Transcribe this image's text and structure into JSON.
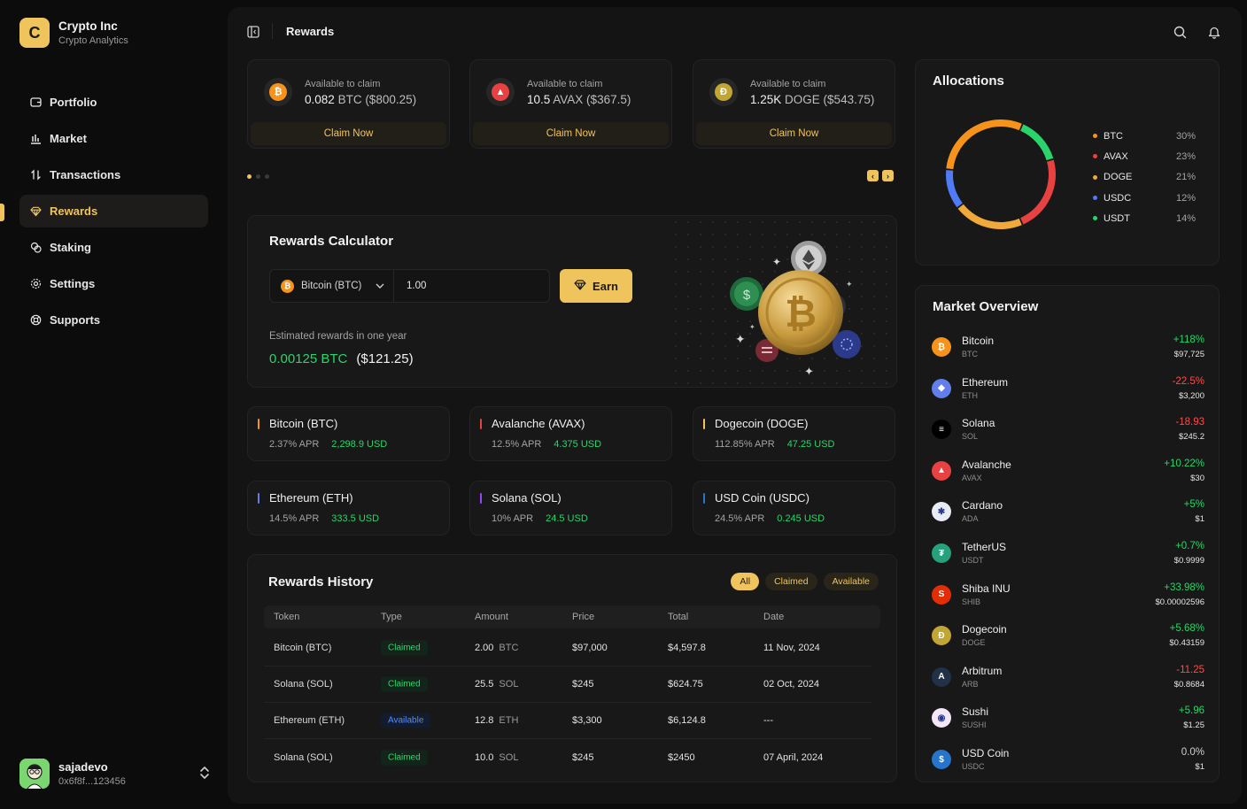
{
  "brand": {
    "logo_letter": "C",
    "name": "Crypto Inc",
    "subtitle": "Crypto Analytics"
  },
  "nav": [
    {
      "label": "Portfolio",
      "icon": "wallet-icon",
      "active": false
    },
    {
      "label": "Market",
      "icon": "chart-bars-icon",
      "active": false
    },
    {
      "label": "Transactions",
      "icon": "arrows-updown-icon",
      "active": false
    },
    {
      "label": "Rewards",
      "icon": "diamond-icon",
      "active": true
    },
    {
      "label": "Staking",
      "icon": "coins-icon",
      "active": false
    },
    {
      "label": "Settings",
      "icon": "gear-icon",
      "active": false
    },
    {
      "label": "Supports",
      "icon": "lifebuoy-icon",
      "active": false
    }
  ],
  "user": {
    "name": "sajadevo",
    "address": "0x6f8f...123456"
  },
  "header": {
    "title": "Rewards"
  },
  "claims": [
    {
      "label": "Available to claim",
      "amount": "0.082",
      "unit": "BTC ($800.25)",
      "button": "Claim Now",
      "symbol": "₿",
      "color": "#f7931a"
    },
    {
      "label": "Available to claim",
      "amount": "10.5",
      "unit": "AVAX ($367.5)",
      "button": "Claim Now",
      "symbol": "▲",
      "color": "#e84142"
    },
    {
      "label": "Available to claim",
      "amount": "1.25K",
      "unit": "DOGE ($543.75)",
      "button": "Claim Now",
      "symbol": "Ð",
      "color": "#c2a633"
    }
  ],
  "calculator": {
    "title": "Rewards Calculator",
    "coin": "Bitcoin (BTC)",
    "amount": "1.00",
    "earn": "Earn",
    "estimate_label": "Estimated rewards in one year",
    "estimate_crypto": "0.00125 BTC",
    "estimate_usd": "($121.25)"
  },
  "apr_cards": [
    {
      "name": "Bitcoin (BTC)",
      "apr": "2.37% APR",
      "usd": "2,298.9 USD",
      "color": "#f7931a"
    },
    {
      "name": "Avalanche (AVAX)",
      "apr": "12.5% APR",
      "usd": "4.375 USD",
      "color": "#e84142"
    },
    {
      "name": "Dogecoin (DOGE)",
      "apr": "112.85% APR",
      "usd": "47.25 USD",
      "color": "#f0c45c"
    },
    {
      "name": "Ethereum (ETH)",
      "apr": "14.5% APR",
      "usd": "333.5 USD",
      "color": "#627eea"
    },
    {
      "name": "Solana (SOL)",
      "apr": "10% APR",
      "usd": "24.5 USD",
      "color": "#9945ff"
    },
    {
      "name": "USD Coin (USDC)",
      "apr": "24.5% APR",
      "usd": "0.245 USD",
      "color": "#2775ca"
    }
  ],
  "history": {
    "title": "Rewards History",
    "filters": [
      "All",
      "Claimed",
      "Available"
    ],
    "columns": [
      "Token",
      "Type",
      "Amount",
      "Price",
      "Total",
      "Date"
    ],
    "rows": [
      {
        "token": "Bitcoin (BTC)",
        "type": "Claimed",
        "amount": "2.00",
        "unit": "BTC",
        "price": "$97,000",
        "total": "$4,597.8",
        "date": "11 Nov, 2024"
      },
      {
        "token": "Solana (SOL)",
        "type": "Claimed",
        "amount": "25.5",
        "unit": "SOL",
        "price": "$245",
        "total": "$624.75",
        "date": "02 Oct, 2024"
      },
      {
        "token": "Ethereum (ETH)",
        "type": "Available",
        "amount": "12.8",
        "unit": "ETH",
        "price": "$3,300",
        "total": "$6,124.8",
        "date": "---"
      },
      {
        "token": "Solana (SOL)",
        "type": "Claimed",
        "amount": "10.0",
        "unit": "SOL",
        "price": "$245",
        "total": "$2450",
        "date": "07 April, 2024"
      }
    ]
  },
  "allocations": {
    "title": "Allocations",
    "items": [
      {
        "label": "BTC",
        "pct": "30%",
        "value": 30,
        "color": "#f7931a"
      },
      {
        "label": "AVAX",
        "pct": "23%",
        "value": 23,
        "color": "#e84142"
      },
      {
        "label": "DOGE",
        "pct": "21%",
        "value": 21,
        "color": "#f0a93b"
      },
      {
        "label": "USDC",
        "pct": "12%",
        "value": 12,
        "color": "#4f7cf6"
      },
      {
        "label": "USDT",
        "pct": "14%",
        "value": 14,
        "color": "#2bd46b"
      }
    ]
  },
  "market": {
    "title": "Market Overview",
    "items": [
      {
        "name": "Bitcoin",
        "symbol": "BTC",
        "change": "+118%",
        "price": "$97,725",
        "trend": "up",
        "color": "#f7931a",
        "glyph": "₿"
      },
      {
        "name": "Ethereum",
        "symbol": "ETH",
        "change": "-22.5%",
        "price": "$3,200",
        "trend": "down",
        "color": "#627eea",
        "glyph": "◆"
      },
      {
        "name": "Solana",
        "symbol": "SOL",
        "change": "-18.93",
        "price": "$245.2",
        "trend": "down",
        "color": "#000000",
        "glyph": "≡"
      },
      {
        "name": "Avalanche",
        "symbol": "AVAX",
        "change": "+10.22%",
        "price": "$30",
        "trend": "up",
        "color": "#e84142",
        "glyph": "▲"
      },
      {
        "name": "Cardano",
        "symbol": "ADA",
        "change": "+5%",
        "price": "$1",
        "trend": "up",
        "color": "#e8ecf8",
        "glyph": "✱"
      },
      {
        "name": "TetherUS",
        "symbol": "USDT",
        "change": "+0.7%",
        "price": "$0.9999",
        "trend": "up",
        "color": "#26a17b",
        "glyph": "₮"
      },
      {
        "name": "Shiba INU",
        "symbol": "SHIB",
        "change": "+33.98%",
        "price": "$0.00002596",
        "trend": "up",
        "color": "#e42d04",
        "glyph": "S"
      },
      {
        "name": "Dogecoin",
        "symbol": "DOGE",
        "change": "+5.68%",
        "price": "$0.43159",
        "trend": "up",
        "color": "#c2a633",
        "glyph": "Ð"
      },
      {
        "name": "Arbitrum",
        "symbol": "ARB",
        "change": "-11.25",
        "price": "$0.8684",
        "trend": "down",
        "color": "#213147",
        "glyph": "A"
      },
      {
        "name": "Sushi",
        "symbol": "SUSHI",
        "change": "+5.96",
        "price": "$1.25",
        "trend": "up",
        "color": "#f2e6f7",
        "glyph": "◉"
      },
      {
        "name": "USD Coin",
        "symbol": "USDC",
        "change": "0.0%",
        "price": "$1",
        "trend": "flat",
        "color": "#2775ca",
        "glyph": "$"
      }
    ]
  }
}
